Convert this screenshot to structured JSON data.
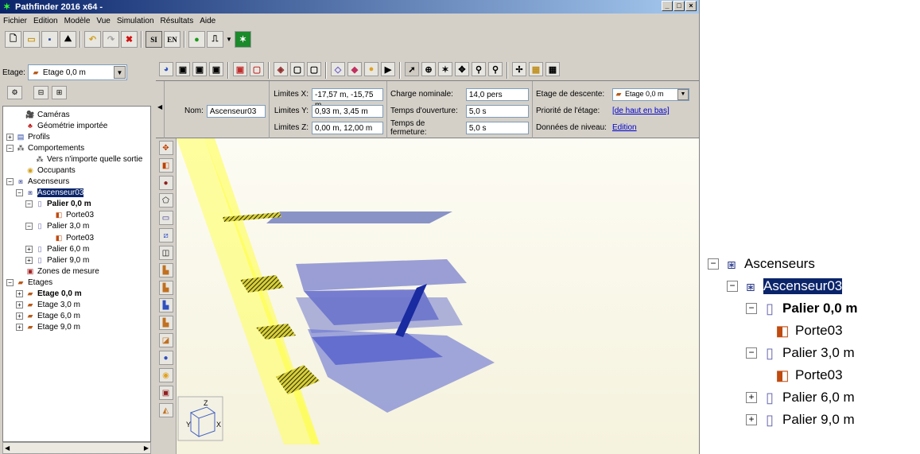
{
  "window": {
    "title": "Pathfinder 2016 x64 -",
    "controls": [
      "_",
      "□",
      "×"
    ]
  },
  "menu": [
    "Fichier",
    "Edition",
    "Modèle",
    "Vue",
    "Simulation",
    "Résultats",
    "Aide"
  ],
  "toolbar": {
    "si_label": "SI",
    "en_label": "EN"
  },
  "floor_selector": {
    "label": "Etage:",
    "value": "Etage 0,0 m"
  },
  "tree": [
    {
      "label": "Caméras",
      "icon": "camera-icon",
      "indent": 1,
      "exp": ""
    },
    {
      "label": "Géométrie importée",
      "icon": "geometry-icon",
      "indent": 1,
      "exp": ""
    },
    {
      "label": "Profils",
      "icon": "profile-icon",
      "indent": 0,
      "exp": "+"
    },
    {
      "label": "Comportements",
      "icon": "behavior-icon",
      "indent": 0,
      "exp": "-"
    },
    {
      "label": "Vers n'importe quelle sortie",
      "icon": "behavior-icon",
      "indent": 2,
      "exp": ""
    },
    {
      "label": "Occupants",
      "icon": "occupants-icon",
      "indent": 1,
      "exp": ""
    },
    {
      "label": "Ascenseurs",
      "icon": "elevator-icon",
      "indent": 0,
      "exp": "-"
    },
    {
      "label": "Ascenseur03",
      "icon": "elevator-icon",
      "indent": 1,
      "exp": "-",
      "selected": true
    },
    {
      "label": "Palier 0,0 m",
      "icon": "landing-icon",
      "indent": 2,
      "exp": "-",
      "bold": true
    },
    {
      "label": "Porte03",
      "icon": "door-icon",
      "indent": 4,
      "exp": ""
    },
    {
      "label": "Palier 3,0 m",
      "icon": "landing-icon",
      "indent": 2,
      "exp": "-"
    },
    {
      "label": "Porte03",
      "icon": "door-icon",
      "indent": 4,
      "exp": ""
    },
    {
      "label": "Palier 6,0 m",
      "icon": "landing-icon",
      "indent": 2,
      "exp": "+"
    },
    {
      "label": "Palier 9,0 m",
      "icon": "landing-icon",
      "indent": 2,
      "exp": "+"
    },
    {
      "label": "Zones de mesure",
      "icon": "measure-icon",
      "indent": 1,
      "exp": ""
    },
    {
      "label": "Etages",
      "icon": "floors-icon",
      "indent": 0,
      "exp": "-"
    },
    {
      "label": "Etage 0,0 m",
      "icon": "floor-icon",
      "indent": 1,
      "exp": "+",
      "bold": true
    },
    {
      "label": "Etage 3,0 m",
      "icon": "floor-icon",
      "indent": 1,
      "exp": "+"
    },
    {
      "label": "Etage 6,0 m",
      "icon": "floor-icon",
      "indent": 1,
      "exp": "+"
    },
    {
      "label": "Etage 9,0 m",
      "icon": "floor-icon",
      "indent": 1,
      "exp": "+"
    }
  ],
  "props": {
    "nom_label": "Nom:",
    "nom_value": "Ascenseur03",
    "limx_label": "Limites X:",
    "limx_value": "-17,57 m, -15,75 m",
    "limy_label": "Limites Y:",
    "limy_value": "0,93 m, 3,45 m",
    "limz_label": "Limites Z:",
    "limz_value": "0,00 m, 12,00 m",
    "charge_label": "Charge nominale:",
    "charge_value": "14,0 pers",
    "ouv_label": "Temps d'ouverture:",
    "ouv_value": "5,0 s",
    "ferm_label": "Temps de fermeture:",
    "ferm_value": "5,0 s",
    "descente_label": "Etage de descente:",
    "descente_value": "Etage 0,0 m",
    "priorite_label": "Priorité de l'étage:",
    "priorite_value": "[de haut en bas]",
    "donnees_label": "Données de niveau:",
    "donnees_value": "Edition"
  },
  "zoom_tree": [
    {
      "label": "Ascenseurs",
      "icon": "elevator-icon",
      "exp": "-",
      "indent": 0
    },
    {
      "label": "Ascenseur03",
      "icon": "elevator-icon",
      "exp": "-",
      "indent": 1,
      "selected": true
    },
    {
      "label": "Palier 0,0 m",
      "icon": "landing-icon",
      "exp": "-",
      "indent": 2,
      "bold": true
    },
    {
      "label": "Porte03",
      "icon": "door-icon",
      "exp": "",
      "indent": 3
    },
    {
      "label": "Palier 3,0 m",
      "icon": "landing-icon",
      "exp": "-",
      "indent": 2
    },
    {
      "label": "Porte03",
      "icon": "door-icon",
      "exp": "",
      "indent": 3
    },
    {
      "label": "Palier 6,0 m",
      "icon": "landing-icon",
      "exp": "+",
      "indent": 2
    },
    {
      "label": "Palier 9,0 m",
      "icon": "landing-icon",
      "exp": "+",
      "indent": 2
    }
  ],
  "axes": {
    "x": "X",
    "y": "Y",
    "z": "Z"
  },
  "colors": {
    "elevator_shaft": "#ffff66",
    "floor_plate": "#5050d0",
    "stair": "#1a2aa0",
    "title_bar": "#0a246a"
  }
}
